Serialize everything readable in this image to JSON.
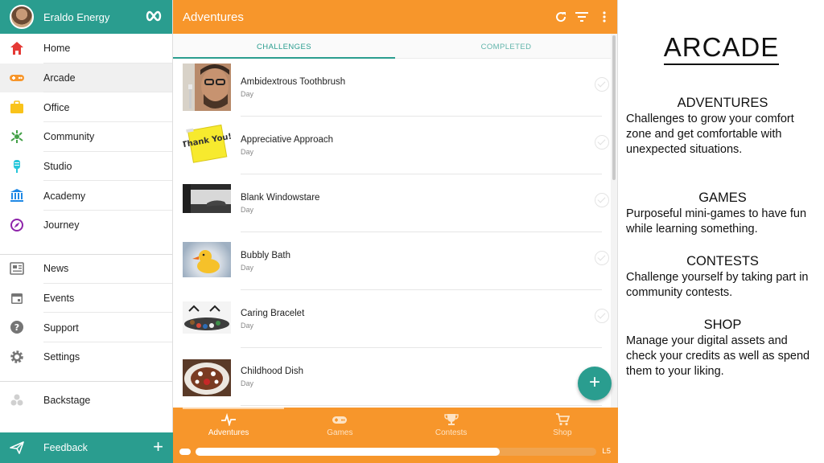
{
  "sidebar": {
    "profile_name": "Eraldo Energy",
    "loop_icon": "infinity-loop-icon",
    "items_top": [
      {
        "label": "Home",
        "icon": "home-icon",
        "color": "#e53935"
      },
      {
        "label": "Arcade",
        "icon": "gamepad-icon",
        "color": "#f7962b"
      },
      {
        "label": "Office",
        "icon": "briefcase-icon",
        "color": "#f9c31a"
      },
      {
        "label": "Community",
        "icon": "community-icon",
        "color": "#43a047"
      },
      {
        "label": "Studio",
        "icon": "microphone-icon",
        "color": "#26c6da"
      },
      {
        "label": "Academy",
        "icon": "academy-building-icon",
        "color": "#1e88e5"
      },
      {
        "label": "Journey",
        "icon": "compass-icon",
        "color": "#8e24aa"
      }
    ],
    "items_mid": [
      {
        "label": "News",
        "icon": "newspaper-icon",
        "color": "#757575"
      },
      {
        "label": "Events",
        "icon": "calendar-icon",
        "color": "#757575"
      },
      {
        "label": "Support",
        "icon": "help-icon",
        "color": "#757575"
      },
      {
        "label": "Settings",
        "icon": "gear-icon",
        "color": "#757575"
      }
    ],
    "backstage_label": "Backstage",
    "feedback_label": "Feedback",
    "active_item": "Arcade"
  },
  "appbar": {
    "title": "Adventures",
    "icons": [
      "refresh-icon",
      "filter-icon",
      "more-vertical-icon"
    ]
  },
  "tabs": [
    {
      "label": "CHALLENGES",
      "active": true
    },
    {
      "label": "COMPLETED",
      "active": false
    }
  ],
  "challenges": [
    {
      "title": "Ambidextrous Toothbrush",
      "subtitle": "Day",
      "thumb": "man-with-toothbrush-photo"
    },
    {
      "title": "Appreciative Approach",
      "subtitle": "Day",
      "thumb": "thank-you-sticky-note-photo",
      "thumb_text": "Thank You!"
    },
    {
      "title": "Blank Windowstare",
      "subtitle": "Day",
      "thumb": "window-view-photo"
    },
    {
      "title": "Bubbly Bath",
      "subtitle": "Day",
      "thumb": "rubber-duck-photo"
    },
    {
      "title": "Caring Bracelet",
      "subtitle": "Day",
      "thumb": "bracelet-beads-photo"
    },
    {
      "title": "Childhood Dish",
      "subtitle": "Day",
      "thumb": "cake-dish-photo"
    }
  ],
  "bottom_nav": [
    {
      "label": "Adventures",
      "icon": "pulse-icon",
      "active": true
    },
    {
      "label": "Games",
      "icon": "gamepad-icon",
      "active": false
    },
    {
      "label": "Contests",
      "icon": "trophy-icon",
      "active": false
    },
    {
      "label": "Shop",
      "icon": "cart-icon",
      "active": false
    }
  ],
  "level": {
    "label": "L5",
    "progress": 0.76
  },
  "colors": {
    "teal": "#2a9d8f",
    "orange": "#f7962b"
  },
  "info": {
    "title": "ARCADE",
    "sections": [
      {
        "heading": "ADVENTURES",
        "body": "Challenges to grow your comfort zone and get comfortable with unexpected situations."
      },
      {
        "heading": "GAMES",
        "body": "Purposeful mini-games to have fun while learning something."
      },
      {
        "heading": "CONTESTS",
        "body": "Challenge yourself by taking part in community contests."
      },
      {
        "heading": "SHOP",
        "body": "Manage your digital assets and check your credits as well as spend them to your liking."
      }
    ]
  }
}
